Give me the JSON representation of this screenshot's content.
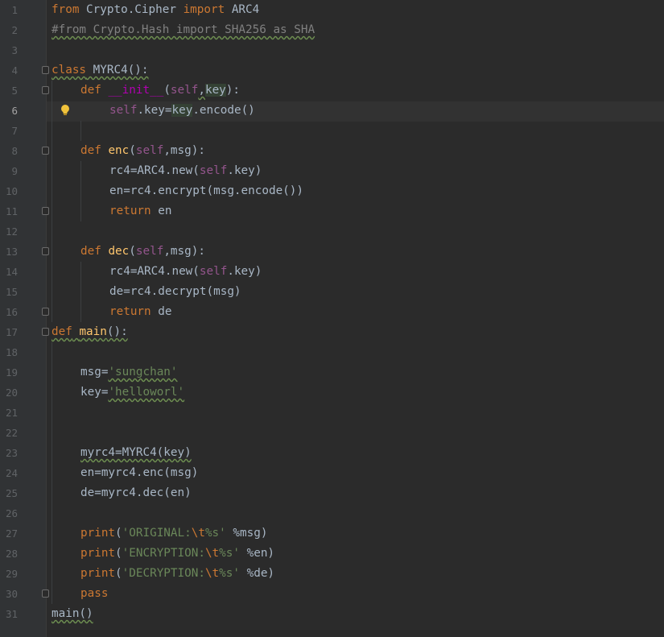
{
  "editor": {
    "current_line": "6",
    "line_numbers": [
      "1",
      "2",
      "3",
      "4",
      "5",
      "6",
      "7",
      "8",
      "9",
      "10",
      "11",
      "12",
      "13",
      "14",
      "15",
      "16",
      "17",
      "18",
      "19",
      "20",
      "21",
      "22",
      "23",
      "24",
      "25",
      "26",
      "27",
      "28",
      "29",
      "30",
      "31"
    ],
    "code": {
      "l1": {
        "from": "from",
        "mod": " Crypto.Cipher ",
        "import": "import",
        "name": " ARC4"
      },
      "l2": {
        "comment": "#from Crypto.Hash import SHA256 as SHA"
      },
      "l4": {
        "class": "class",
        "name": " MYRC4():"
      },
      "l5": {
        "def": "def",
        "sp": " ",
        "init": "__init__",
        "open": "(",
        "self": "self",
        "comma": ",",
        "key": "key",
        "close": "):"
      },
      "l6": {
        "self": "self",
        "dot_key": ".key=",
        "key": "key",
        "rest": ".encode()"
      },
      "l8": {
        "def": "def",
        "sp": " ",
        "fn": "enc",
        "open": "(",
        "self": "self",
        "rest": ",msg):"
      },
      "l9": {
        "pre": "rc4=ARC4.new(",
        "self": "self",
        "post": ".key)"
      },
      "l10": {
        "text": "en=rc4.encrypt(msg.encode())"
      },
      "l11": {
        "return": "return",
        "rest": " en"
      },
      "l13": {
        "def": "def",
        "sp": " ",
        "fn": "dec",
        "open": "(",
        "self": "self",
        "rest": ",msg):"
      },
      "l14": {
        "pre": "rc4=ARC4.new(",
        "self": "self",
        "post": ".key)"
      },
      "l15": {
        "text": "de=rc4.decrypt(msg)"
      },
      "l16": {
        "return": "return",
        "rest": " de"
      },
      "l17": {
        "def": "def",
        "sp": " ",
        "fn": "main",
        "rest": "():"
      },
      "l19": {
        "pre": "msg=",
        "str": "'sungchan'"
      },
      "l20": {
        "pre": "key=",
        "str": "'helloworl'"
      },
      "l23": {
        "text": "myrc4=MYRC4(key)"
      },
      "l24": {
        "text": "en=myrc4.enc(msg)"
      },
      "l25": {
        "text": "de=myrc4.dec(en)"
      },
      "l27": {
        "print": "print",
        "open": "(",
        "s1": "'ORIGINAL:",
        "esc": "\\t",
        "s2": "%s'",
        "rest": " %msg)"
      },
      "l28": {
        "print": "print",
        "open": "(",
        "s1": "'ENCRYPTION:",
        "esc": "\\t",
        "s2": "%s'",
        "rest": " %en)"
      },
      "l29": {
        "print": "print",
        "open": "(",
        "s1": "'DECRYPTION:",
        "esc": "\\t",
        "s2": "%s'",
        "rest": " %de)"
      },
      "l30": {
        "pass": "pass"
      },
      "l31": {
        "text": "main()"
      }
    },
    "icons": {
      "intention": "lightbulb-icon",
      "fold": "fold-marker-icon"
    },
    "colors": {
      "background": "#2b2b2b",
      "keyword": "#cc7832",
      "string": "#6a8759",
      "function": "#ffc66d",
      "self": "#94558d",
      "comment": "#808080",
      "default": "#a9b7c6"
    }
  }
}
